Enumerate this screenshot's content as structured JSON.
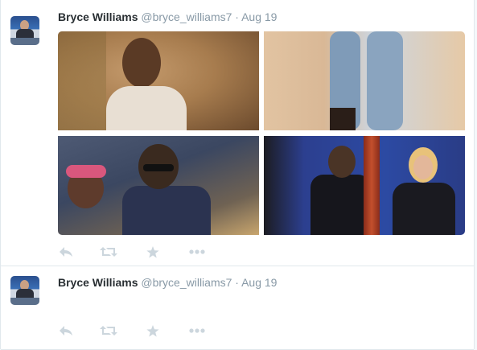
{
  "tweets": [
    {
      "fullname": "Bryce Williams",
      "handle": "@bryce_williams7",
      "separator": "·",
      "time": "Aug 19",
      "has_media": true
    },
    {
      "fullname": "Bryce Williams",
      "handle": "@bryce_williams7",
      "separator": "·",
      "time": "Aug 19",
      "has_media": false
    }
  ],
  "icons": {
    "reply": "reply-icon",
    "retweet": "retweet-icon",
    "favorite": "star-icon",
    "more": "more-icon"
  },
  "colors": {
    "name": "#292f33",
    "meta": "#8899a6",
    "action_icon": "#ccd6dd",
    "border": "#e1e8ed"
  }
}
